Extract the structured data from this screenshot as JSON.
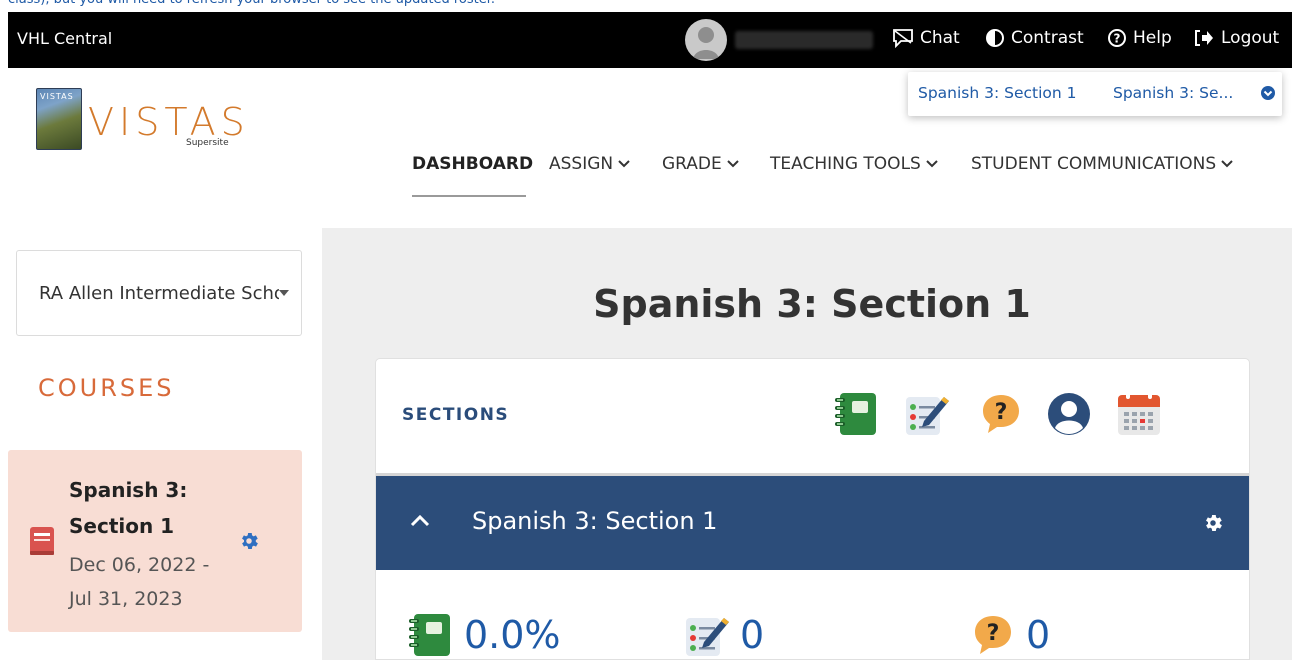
{
  "snippet": "class), but you will need to refresh your browser to see the updated roster.",
  "topbar": {
    "brand": "VHL Central",
    "links": {
      "chat": "Chat",
      "contrast": "Contrast",
      "help": "Help",
      "logout": "Logout"
    }
  },
  "section_switcher": {
    "items": [
      "Spanish 3: Section 1",
      "Spanish 3: Se..."
    ]
  },
  "logo": {
    "book_label": "VISTAS",
    "wordmark": "VISTAS",
    "subtitle": "Supersite"
  },
  "nav": {
    "items": [
      {
        "label": "DASHBOARD",
        "active": true
      },
      {
        "label": "ASSIGN"
      },
      {
        "label": "GRADE"
      },
      {
        "label": "TEACHING TOOLS"
      },
      {
        "label": "STUDENT COMMUNICATIONS"
      }
    ]
  },
  "sidebar": {
    "school": "RA Allen Intermediate School",
    "courses_label": "COURSES",
    "course": {
      "title": "Spanish 3: Section 1",
      "dates": "Dec 06, 2022 - Jul 31, 2023"
    }
  },
  "main": {
    "title": "Spanish 3: Section 1",
    "sections_label": "SECTIONS",
    "section_row": {
      "title": "Spanish 3: Section 1"
    },
    "stats": {
      "gradebook": "0.0%",
      "assignments": "0",
      "questions": "0"
    }
  },
  "colors": {
    "accent_blue": "#1f5aa6",
    "section_bar": "#2c4d7a",
    "courses_orange": "#d86a3a",
    "course_card_bg": "#f8ddd4"
  },
  "icons": {
    "toolbar": [
      "gradebook-icon",
      "assignment-icon",
      "question-icon",
      "user-icon",
      "calendar-icon"
    ]
  }
}
